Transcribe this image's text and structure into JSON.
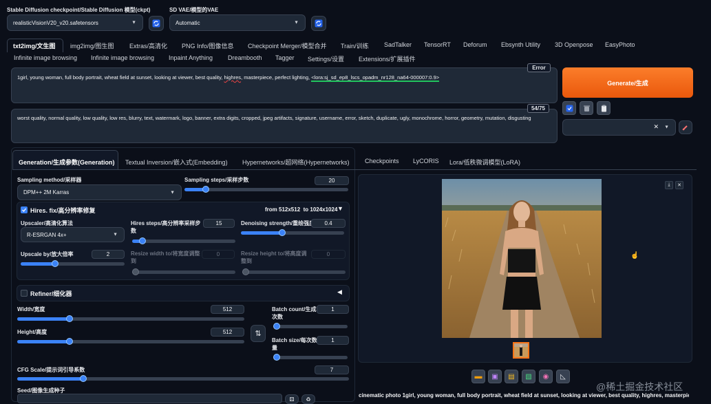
{
  "header": {
    "checkpoint_label": "Stable Diffusion checkpoint/Stable Diffusion 模型(ckpt)",
    "checkpoint_value": "realisticVisionV20_v20.safetensors",
    "vae_label": "SD VAE/模型的VAE",
    "vae_value": "Automatic"
  },
  "tabs_row1": [
    "txt2img/文生图",
    "img2img/图生图",
    "Extras/高清化",
    "PNG Info/图像信息",
    "Checkpoint Merger/模型合并",
    "Train/训练",
    "SadTalker",
    "TensorRT",
    "Deforum",
    "Ebsynth Utility",
    "3D Openpose",
    "EasyPhoto"
  ],
  "tabs_row2": [
    "Infinite image browsing",
    "Infinite image browsing",
    "Inpaint Anything",
    "Dreambooth",
    "Tagger",
    "Settings/设置",
    "Extensions/扩展插件"
  ],
  "prompt": {
    "text_before": "1girl, young woman, full body portrait, wheat field at sunset, looking at viewer,  best quality, ",
    "text_misspelled": "highres",
    "text_middle": ", masterpiece, perfect lighting, ",
    "text_lora": "<lora:sj_sd_ep8_lscs_opadm_nr128_na64-000007:0.9>",
    "badge": "Error"
  },
  "negative_prompt": {
    "text": "worst quality, normal quality, low quality, low res, blurry, text, watermark, logo, banner, extra digits, cropped, jpeg artifacts, signature, username, error, sketch, duplicate, ugly, monochrome, horror, geometry, mutation, disgusting",
    "token_count": "54/75"
  },
  "generate_label": "Generate/生成",
  "param_tabs": [
    "Generation/生成参数(Generation)",
    "Textual Inversion/嵌入式(Embedding)",
    "Hypernetworks/超网络(Hypernetworks)",
    "Checkpoints",
    "LyCORIS",
    "Lora/低秩微调模型(LoRA)"
  ],
  "sampler": {
    "label": "Sampling method/采样器",
    "value": "DPM++ 2M Karras",
    "steps_label": "Sampling steps/采样步数",
    "steps_value": "20",
    "steps_fraction": 0.13
  },
  "hires": {
    "title": "Hires. fix/高分辨率修复",
    "resolution": "from 512x512  to 1024x1024",
    "upscaler_label": "Upscaler/高清化算法",
    "upscaler_value": "R-ESRGAN 4x+",
    "steps_label": "Hires steps/高分辨率采样步数",
    "steps_value": "15",
    "steps_fraction": 0.1,
    "denoise_label": "Denoising strength/重绘强度",
    "denoise_value": "0.4",
    "denoise_fraction": 0.4,
    "upscale_by_label": "Upscale by/放大倍率",
    "upscale_by_value": "2",
    "upscale_by_fraction": 0.33,
    "resize_w_label": "Resize width to/将宽度调整到",
    "resize_w_value": "0",
    "resize_h_label": "Resize height to/将高度调整到",
    "resize_h_value": "0"
  },
  "refiner_title": "Refiner/细化器",
  "size": {
    "width_label": "Width/宽度",
    "width_value": "512",
    "width_fraction": 0.23,
    "height_label": "Height/高度",
    "height_value": "512",
    "height_fraction": 0.23,
    "batch_count_label": "Batch count/生成次数",
    "batch_count_value": "1",
    "batch_size_label": "Batch size/每次数量",
    "batch_size_value": "1"
  },
  "cfg": {
    "label": "CFG Scale/提示词引导系数",
    "value": "7",
    "fraction": 0.2
  },
  "seed_label": "Seed/图像生成种子",
  "output_caption": "cinematic photo 1girl, young woman, full body portrait, wheat field at sunset, looking at viewer, best quality, highres, masterpiece,",
  "watermark": "@稀土掘金技术社区",
  "colors": {
    "accent": "#3b82f6",
    "generate": "#f97316",
    "background": "#0b0f19"
  }
}
